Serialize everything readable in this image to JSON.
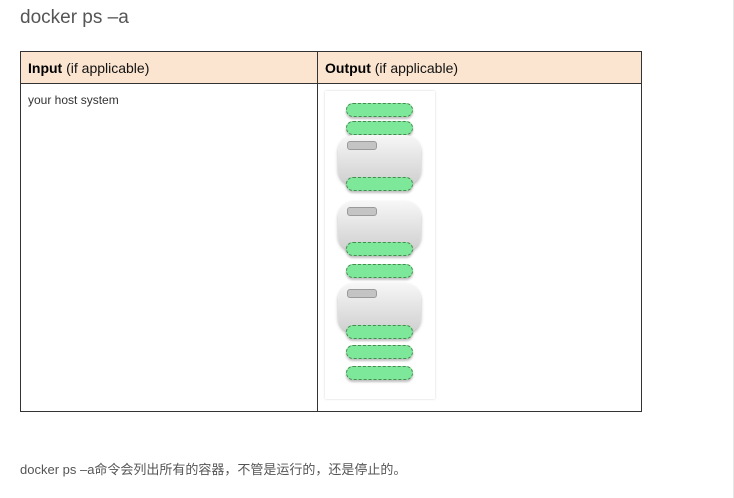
{
  "title": "docker ps –a",
  "table": {
    "headers": [
      {
        "bold": "Input",
        "rest": " (if applicable)"
      },
      {
        "bold": "Output",
        "rest": " (if applicable)"
      }
    ],
    "input_text": "your host system"
  },
  "diagram": {
    "layer_color": "#7ee89a",
    "container_color": "#e0e0e0"
  },
  "description": "docker ps –a命令会列出所有的容器，不管是运行的，还是停止的。"
}
